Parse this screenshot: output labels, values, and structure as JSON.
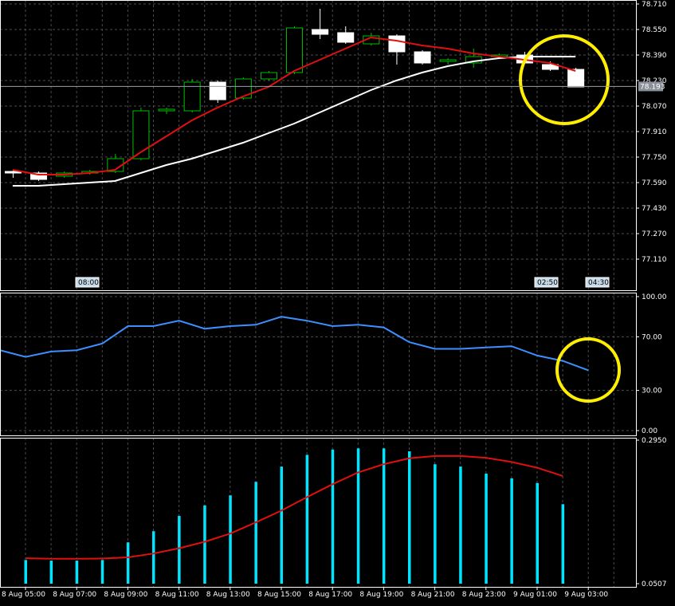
{
  "chart_data": [
    {
      "type": "candlestick",
      "y_ticks": [
        "78.710",
        "78.550",
        "78.390",
        "78.230",
        "78.070",
        "77.910",
        "77.750",
        "77.590",
        "77.430",
        "77.270",
        "77.110"
      ],
      "ylim": [
        77.04,
        78.72
      ],
      "price_label": "78.193",
      "price_value": 78.193,
      "time_markers": [
        "08:00",
        "02:50",
        "04:30"
      ],
      "candles": [
        {
          "o": 77.66,
          "h": 77.67,
          "l": 77.62,
          "c": 77.65
        },
        {
          "o": 77.65,
          "h": 77.66,
          "l": 77.6,
          "c": 77.61
        },
        {
          "o": 77.63,
          "h": 77.66,
          "l": 77.62,
          "c": 77.65
        },
        {
          "o": 77.65,
          "h": 77.67,
          "l": 77.64,
          "c": 77.66
        },
        {
          "o": 77.66,
          "h": 77.77,
          "l": 77.65,
          "c": 77.74
        },
        {
          "o": 77.74,
          "h": 78.06,
          "l": 77.73,
          "c": 78.04
        },
        {
          "o": 78.04,
          "h": 78.06,
          "l": 78.02,
          "c": 78.05
        },
        {
          "o": 78.04,
          "h": 78.24,
          "l": 78.03,
          "c": 78.22
        },
        {
          "o": 78.22,
          "h": 78.23,
          "l": 78.09,
          "c": 78.11
        },
        {
          "o": 78.12,
          "h": 78.25,
          "l": 78.11,
          "c": 78.24
        },
        {
          "o": 78.24,
          "h": 78.29,
          "l": 78.23,
          "c": 78.28
        },
        {
          "o": 78.28,
          "h": 78.57,
          "l": 78.27,
          "c": 78.56
        },
        {
          "o": 78.55,
          "h": 78.68,
          "l": 78.49,
          "c": 78.52
        },
        {
          "o": 78.53,
          "h": 78.57,
          "l": 78.46,
          "c": 78.47
        },
        {
          "o": 78.46,
          "h": 78.53,
          "l": 78.45,
          "c": 78.51
        },
        {
          "o": 78.51,
          "h": 78.52,
          "l": 78.33,
          "c": 78.41
        },
        {
          "o": 78.41,
          "h": 78.42,
          "l": 78.33,
          "c": 78.34
        },
        {
          "o": 78.35,
          "h": 78.37,
          "l": 78.33,
          "c": 78.36
        },
        {
          "o": 78.34,
          "h": 78.43,
          "l": 78.31,
          "c": 78.38
        },
        {
          "o": 78.38,
          "h": 78.4,
          "l": 78.37,
          "c": 78.39
        },
        {
          "o": 78.39,
          "h": 78.41,
          "l": 78.34,
          "c": 78.34
        },
        {
          "o": 78.33,
          "h": 78.35,
          "l": 78.29,
          "c": 78.3
        },
        {
          "o": 78.3,
          "h": 78.31,
          "l": 78.19,
          "c": 78.19
        }
      ],
      "ma_fast": [
        77.67,
        77.64,
        77.64,
        77.65,
        77.67,
        77.78,
        77.88,
        77.98,
        78.06,
        78.13,
        78.19,
        78.29,
        78.36,
        78.43,
        78.5,
        78.48,
        78.45,
        78.43,
        78.4,
        78.38,
        78.36,
        78.34,
        78.29
      ],
      "ma_slow": [
        77.57,
        77.57,
        77.58,
        77.59,
        77.6,
        77.65,
        77.7,
        77.74,
        77.79,
        77.84,
        77.9,
        77.96,
        78.03,
        78.1,
        78.17,
        78.23,
        78.28,
        78.32,
        78.35,
        78.37,
        78.38,
        78.38,
        78.38
      ],
      "circle": {
        "x_index": 21,
        "value": 78.33
      }
    },
    {
      "type": "line",
      "y_ticks": [
        "100.00",
        "70.00",
        "30.00",
        "0.00"
      ],
      "tick_values": [
        100,
        70,
        30,
        0
      ],
      "ylim": [
        0,
        100
      ],
      "values": [
        60,
        55,
        59,
        60,
        65,
        78,
        78,
        82,
        76,
        78,
        79,
        85,
        82,
        78,
        79,
        77,
        66,
        61,
        61,
        62,
        63,
        56,
        52,
        45
      ],
      "line_color": "#3d8fff",
      "circle": {
        "x_index": 23,
        "value": 44
      }
    },
    {
      "type": "bar",
      "y_ticks": [
        "0.2950",
        "0.0507"
      ],
      "tick_values": [
        0.295,
        0.0507
      ],
      "ylim": [
        0.0507,
        0.295
      ],
      "bar_color": "#00e5ff",
      "values": [
        0.091,
        0.09,
        0.09,
        0.091,
        0.121,
        0.14,
        0.166,
        0.184,
        0.201,
        0.224,
        0.25,
        0.27,
        0.279,
        0.281,
        0.281,
        0.276,
        0.254,
        0.25,
        0.238,
        0.23,
        0.222,
        0.186
      ],
      "signal": [
        0.094,
        0.093,
        0.093,
        0.0935,
        0.0955,
        0.102,
        0.111,
        0.122,
        0.136,
        0.155,
        0.175,
        0.198,
        0.22,
        0.24,
        0.254,
        0.264,
        0.268,
        0.268,
        0.265,
        0.258,
        0.248,
        0.234
      ],
      "signal_color": "#e01010"
    }
  ],
  "x_labels": [
    "8 Aug 05:00",
    "8 Aug 07:00",
    "8 Aug 09:00",
    "8 Aug 11:00",
    "8 Aug 13:00",
    "8 Aug 15:00",
    "8 Aug 17:00",
    "8 Aug 19:00",
    "8 Aug 21:00",
    "8 Aug 23:00",
    "9 Aug 01:00",
    "9 Aug 03:00"
  ],
  "colors": {
    "background": "#000000",
    "grid": "#4b4b4b",
    "bull_candle": "#00c000",
    "bear_candle": "#ffffff",
    "ma_fast": "#e01010",
    "ma_slow": "#ffffff",
    "highlight_circle": "#ffee00"
  }
}
